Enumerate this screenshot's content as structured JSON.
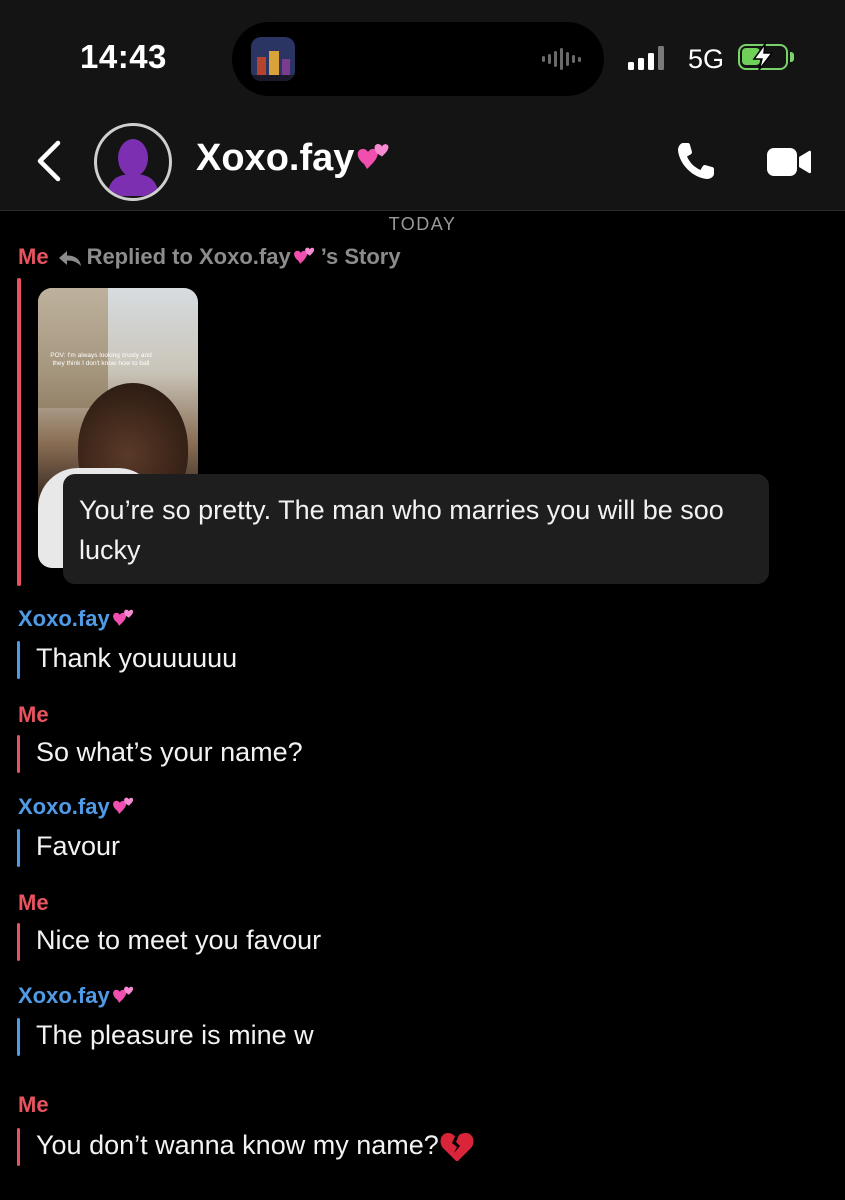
{
  "status_bar": {
    "time": "14:43",
    "network": "5G",
    "colors": {
      "battery": "#6fd15a"
    },
    "icons": [
      "now-playing-art-icon",
      "audio-wave-icon",
      "signal-icon",
      "battery-charging-icon"
    ]
  },
  "header": {
    "contact_name": "Xoxo.fay",
    "contact_emoji": "pink-hearts",
    "icons": [
      "back-chevron-icon",
      "avatar-icon",
      "phone-icon",
      "video-camera-icon"
    ]
  },
  "chat": {
    "date_label": "TODAY",
    "story_reply": {
      "sender": "Me",
      "replied_prefix": "Replied to Xoxo.fay",
      "replied_suffix": "’s Story",
      "story_caption": "POV: I'm always looking crusty and they think I don't know how to ball",
      "comment": "You’re so pretty. The man who marries you will be soo lucky"
    },
    "messages": [
      {
        "sender": "Xoxo.fay",
        "from": "them",
        "text": "Thank youuuuuu"
      },
      {
        "sender": "Me",
        "from": "me",
        "text": "So what’s your name?"
      },
      {
        "sender": "Xoxo.fay",
        "from": "them",
        "text": "Favour"
      },
      {
        "sender": "Me",
        "from": "me",
        "text": "Nice to meet you favour"
      },
      {
        "sender": "Xoxo.fay",
        "from": "them",
        "text": "The pleasure is mine w"
      },
      {
        "sender": "Me",
        "from": "me",
        "text": "You don’t wanna know my name?"
      }
    ],
    "colors": {
      "me": "#e8535f",
      "them": "#4f9be6"
    }
  }
}
